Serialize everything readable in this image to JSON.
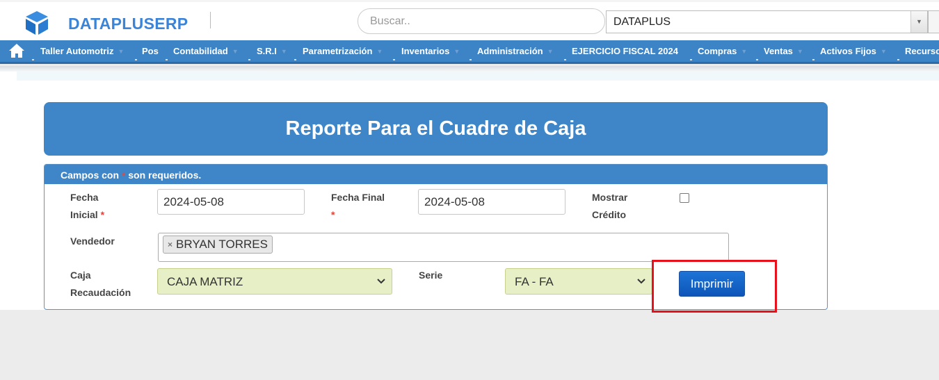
{
  "brand": {
    "name": "DATAPLUSERP"
  },
  "search": {
    "placeholder": "Buscar.."
  },
  "company_select": {
    "value": "DATAPLUS"
  },
  "nav": {
    "items": [
      "Taller Automotriz",
      "Pos",
      "Contabilidad",
      "S.R.I",
      "Parametrización",
      "Inventarios",
      "Administración",
      "EJERCICIO FISCAL 2024",
      "Compras",
      "Ventas",
      "Activos Fijos",
      "Recursos"
    ]
  },
  "page": {
    "title": "Reporte Para el Cuadre de Caja"
  },
  "form": {
    "required_note_prefix": "Campos con ",
    "required_star": "*",
    "required_note_suffix": " son requeridos.",
    "fecha_inicial_label_1": "Fecha",
    "fecha_inicial_label_2": "Inicial",
    "fecha_inicial_value": "2024-05-08",
    "fecha_final_label": "Fecha Final",
    "fecha_final_value": "2024-05-08",
    "mostrar_credito_label_1": "Mostrar",
    "mostrar_credito_label_2": "Crédito",
    "vendedor_label": "Vendedor",
    "vendedor_tag": "BRYAN TORRES",
    "caja_label_1": "Caja",
    "caja_label_2": "Recaudación",
    "caja_value": "CAJA MATRIZ",
    "serie_label": "Serie",
    "serie_value": "FA - FA",
    "print_label": "Imprimir"
  },
  "colors": {
    "nav_bg": "#3d84c6",
    "header_bg": "#3f86c8",
    "select_bg": "#e6efc6",
    "button_bg": "#1565c8",
    "highlight": "#e8101a"
  }
}
